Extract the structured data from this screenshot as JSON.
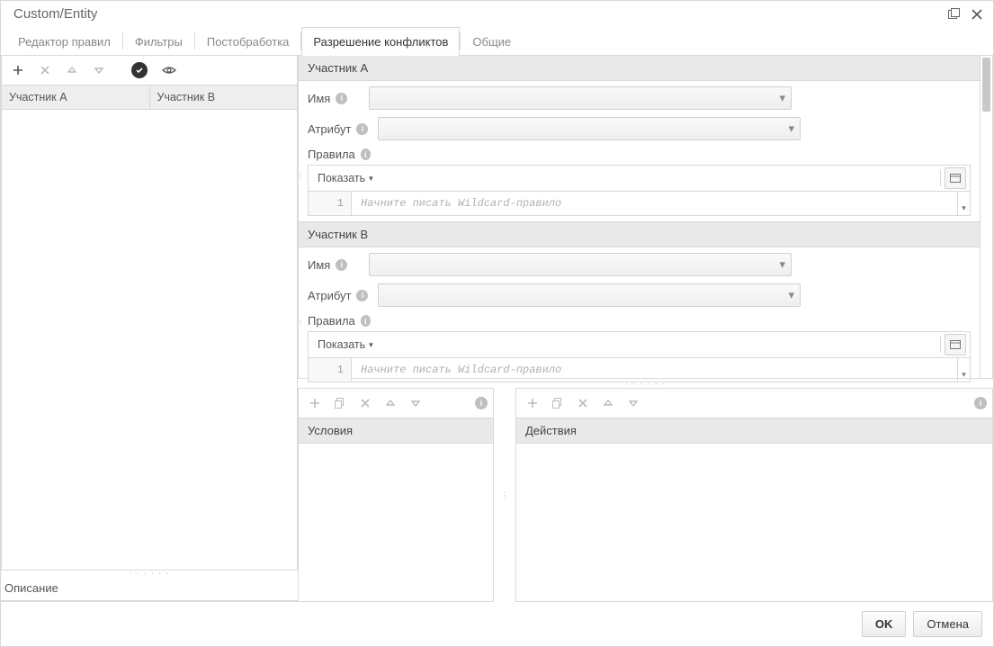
{
  "window": {
    "title": "Custom/Entity"
  },
  "tabs": {
    "items": [
      "Редактор правил",
      "Фильтры",
      "Постобработка",
      "Разрешение конфликтов",
      "Общие"
    ],
    "active_index": 3
  },
  "left": {
    "columns": {
      "a": "Участник A",
      "b": "Участник B"
    },
    "description_label": "Описание"
  },
  "participants": [
    {
      "title": "Участник A",
      "name_label": "Имя",
      "attr_label": "Атрибут",
      "rules_label": "Правила",
      "show_label": "Показать",
      "code_placeholder": "Начните писать Wildcard-правило",
      "line_no": "1"
    },
    {
      "title": "Участник B",
      "name_label": "Имя",
      "attr_label": "Атрибут",
      "rules_label": "Правила",
      "show_label": "Показать",
      "code_placeholder": "Начните писать Wildcard-правило",
      "line_no": "1"
    }
  ],
  "bottom": {
    "conditions_title": "Условия",
    "actions_title": "Действия"
  },
  "footer": {
    "ok": "OK",
    "cancel": "Отмена"
  }
}
